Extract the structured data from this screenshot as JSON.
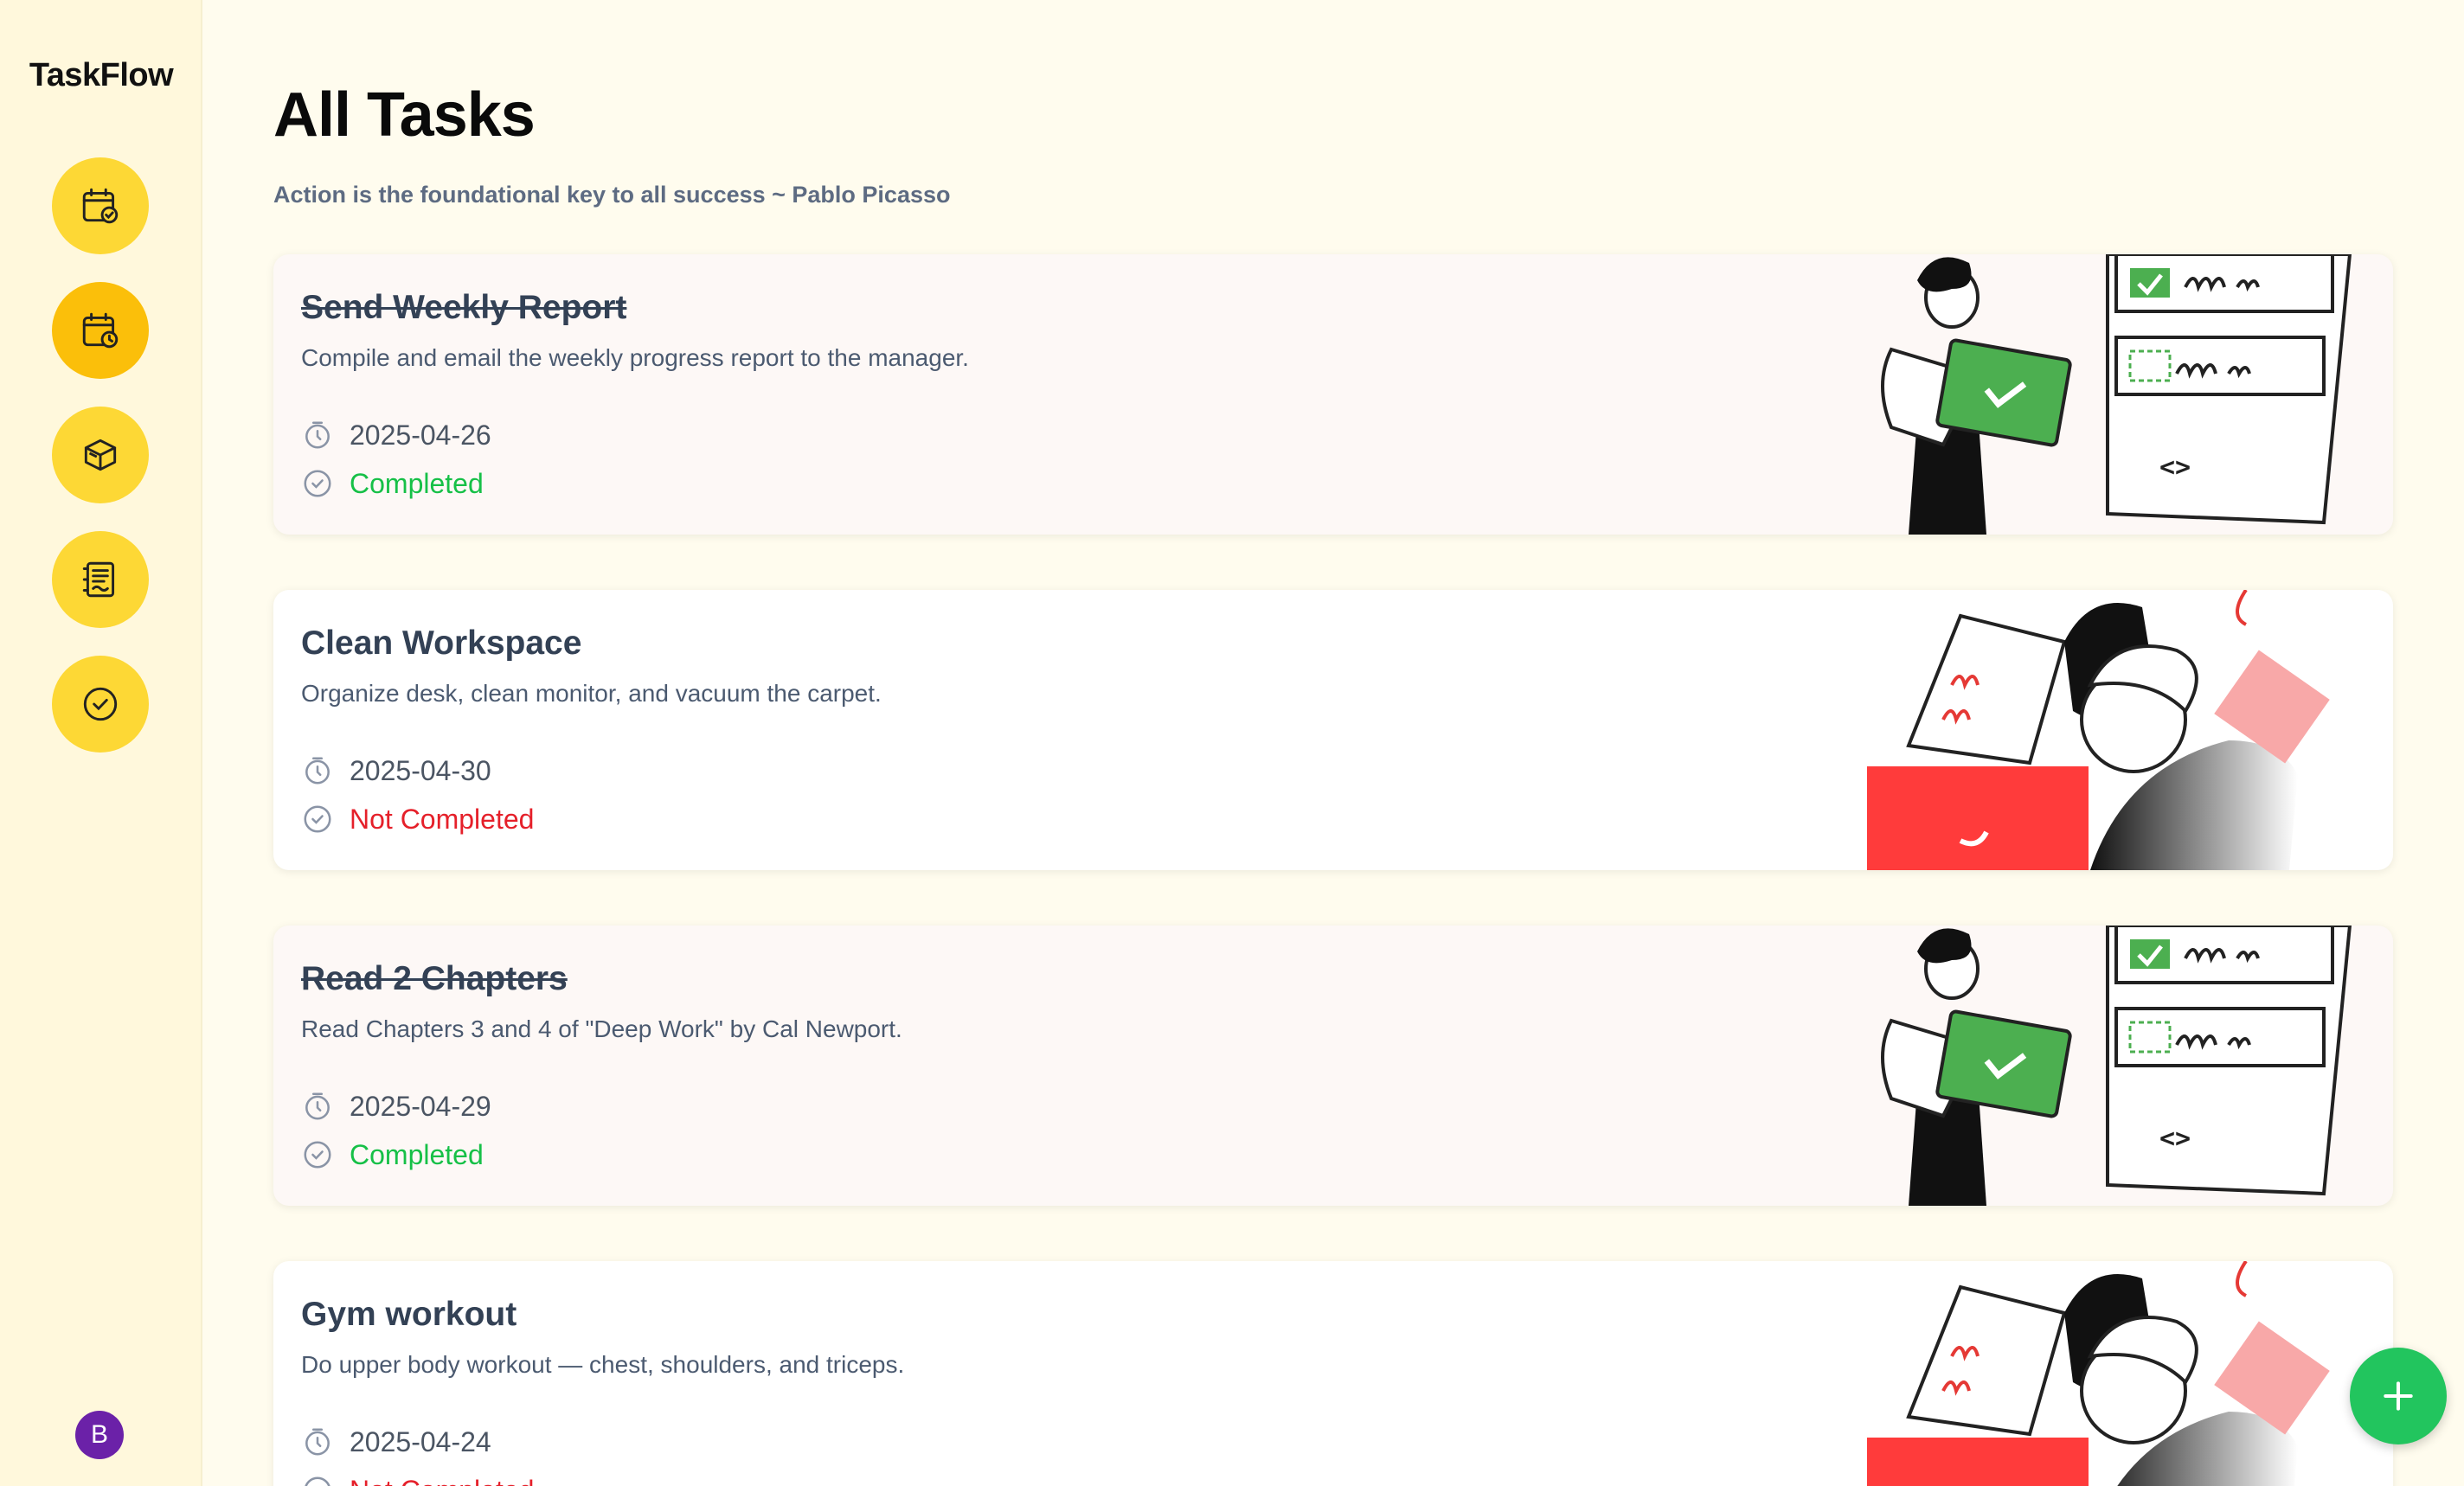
{
  "brand": "TaskFlow",
  "page_title": "All Tasks",
  "quote": "Action is the foundational key to all success ~ Pablo Picasso",
  "nav": [
    {
      "icon": "calendar-check-icon"
    },
    {
      "icon": "calendar-clock-icon",
      "active": true
    },
    {
      "icon": "box-icon"
    },
    {
      "icon": "notes-icon"
    },
    {
      "icon": "check-circle-icon"
    }
  ],
  "avatar_initial": "B",
  "tasks": [
    {
      "title": "Send Weekly Report",
      "description": "Compile and email the weekly progress report to the manager.",
      "date": "2025-04-26",
      "status": "Completed"
    },
    {
      "title": "Clean Workspace",
      "description": "Organize desk, clean monitor, and vacuum the carpet.",
      "date": "2025-04-30",
      "status": "Not Completed"
    },
    {
      "title": "Read 2 Chapters",
      "description": "Read Chapters 3 and 4 of \"Deep Work\" by Cal Newport.",
      "date": "2025-04-29",
      "status": "Completed"
    },
    {
      "title": "Gym workout",
      "description": "Do upper body workout — chest, shoulders, and triceps.",
      "date": "2025-04-24",
      "status": "Not Completed"
    }
  ],
  "colors": {
    "completed": "#16c047",
    "not_completed": "#e5202a",
    "nav_button": "#fdd835",
    "fab": "#22c55e"
  },
  "fab_icon": "plus-icon"
}
